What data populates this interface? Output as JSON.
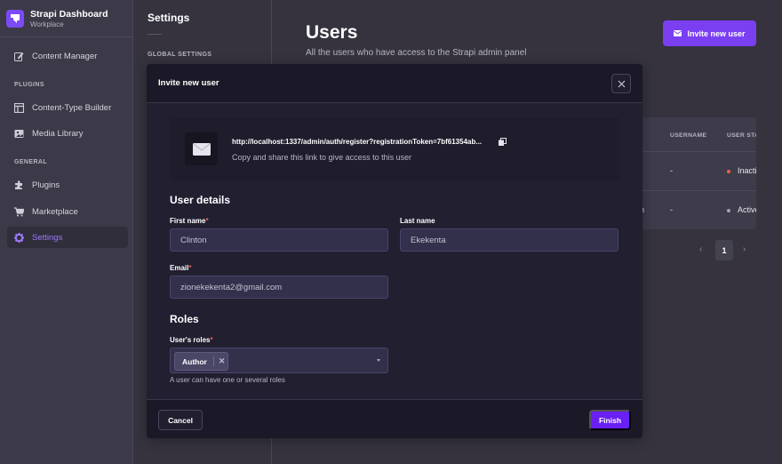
{
  "brand": {
    "name": "Strapi Dashboard",
    "workspace": "Workplace",
    "accent": "#7b4bf5"
  },
  "sidebar": {
    "items": [
      {
        "label": "Content Manager",
        "icon": "pencil-icon"
      },
      {
        "label": "Content-Type Builder",
        "icon": "layout-icon"
      },
      {
        "label": "Media Library",
        "icon": "image-icon"
      },
      {
        "label": "Plugins",
        "icon": "puzzle-icon"
      },
      {
        "label": "Marketplace",
        "icon": "cart-icon"
      },
      {
        "label": "Settings",
        "icon": "gear-icon",
        "active": true
      }
    ],
    "sections": {
      "plugins": "PLUGINS",
      "general": "GENERAL"
    }
  },
  "settings_nav": {
    "title": "Settings",
    "section": "GLOBAL SETTINGS"
  },
  "page": {
    "title": "Users",
    "subtitle": "All the users who have access to the Strapi admin panel",
    "invite_button": "Invite new user"
  },
  "table": {
    "columns": [
      "USERNAME",
      "USER STATUS"
    ],
    "rows": [
      {
        "name_fragment": "",
        "username": "-",
        "status": "Inactive",
        "status_color": "#ee5e52"
      },
      {
        "name_fragment": "in",
        "username": "-",
        "status": "Active",
        "status_color": "#a5a3b5"
      }
    ]
  },
  "pagination": {
    "prev": "‹",
    "current": "1",
    "next": "›"
  },
  "modal": {
    "title": "Invite new user",
    "link": {
      "url": "http://localhost:1337/admin/auth/register?registrationToken=7bf61354ab...",
      "hint": "Copy and share this link to give access to this user"
    },
    "user_details": {
      "heading": "User details",
      "first_name_label": "First name",
      "first_name": "Clinton",
      "last_name_label": "Last name",
      "last_name": "Ekekenta",
      "email_label": "Email",
      "email": "zionekekenta2@gmail.com",
      "required_mark": "*"
    },
    "roles": {
      "heading": "Roles",
      "label": "User's roles",
      "selected": [
        "Author"
      ],
      "remove_glyph": "✕",
      "hint": "A user can have one or several roles"
    },
    "cancel": "Cancel",
    "finish": "Finish"
  }
}
